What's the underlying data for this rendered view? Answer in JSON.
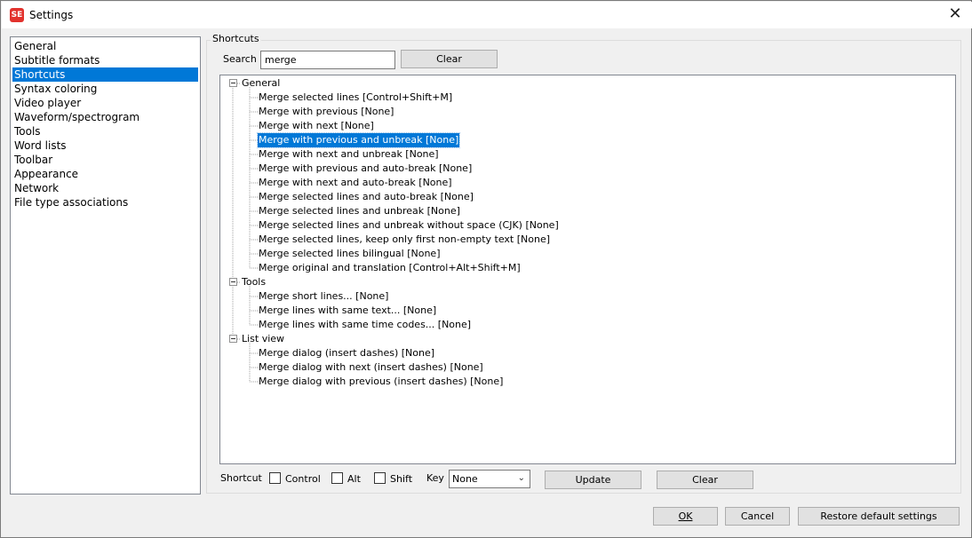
{
  "window": {
    "title": "Settings",
    "icon_text": "SE"
  },
  "categories": [
    "General",
    "Subtitle formats",
    "Shortcuts",
    "Syntax coloring",
    "Video player",
    "Waveform/spectrogram",
    "Tools",
    "Word lists",
    "Toolbar",
    "Appearance",
    "Network",
    "File type associations"
  ],
  "selected_category": "Shortcuts",
  "shortcuts": {
    "group_label": "Shortcuts",
    "search_label": "Search",
    "search_value": "merge",
    "clear_label": "Clear",
    "tree": [
      {
        "label": "General",
        "children": [
          "Merge selected lines [Control+Shift+M]",
          "Merge with previous [None]",
          "Merge with next [None]",
          "Merge with previous and unbreak [None]",
          "Merge with next and unbreak [None]",
          "Merge with previous and auto-break [None]",
          "Merge with next and auto-break [None]",
          "Merge selected lines and auto-break [None]",
          "Merge selected lines and unbreak [None]",
          "Merge selected lines and unbreak without space (CJK) [None]",
          "Merge selected lines, keep only first non-empty text [None]",
          "Merge selected lines bilingual [None]",
          "Merge original and translation [Control+Alt+Shift+M]"
        ]
      },
      {
        "label": "Tools",
        "children": [
          "Merge short lines... [None]",
          "Merge lines with same text... [None]",
          "Merge lines with same time codes... [None]"
        ]
      },
      {
        "label": "List view",
        "children": [
          "Merge dialog (insert dashes) [None]",
          "Merge dialog with next (insert dashes) [None]",
          "Merge dialog with previous (insert dashes) [None]"
        ]
      }
    ],
    "selected_node": "Merge with previous and unbreak [None]",
    "editor": {
      "shortcut_label": "Shortcut",
      "control_label": "Control",
      "control_checked": false,
      "alt_label": "Alt",
      "alt_checked": false,
      "shift_label": "Shift",
      "shift_checked": false,
      "key_label": "Key",
      "key_value": "None",
      "update_label": "Update",
      "clear_label": "Clear"
    }
  },
  "footer": {
    "ok_label": "OK",
    "cancel_label": "Cancel",
    "restore_label": "Restore default settings"
  },
  "colors": {
    "selection": "#0078d7",
    "app_icon": "#e2322d"
  }
}
